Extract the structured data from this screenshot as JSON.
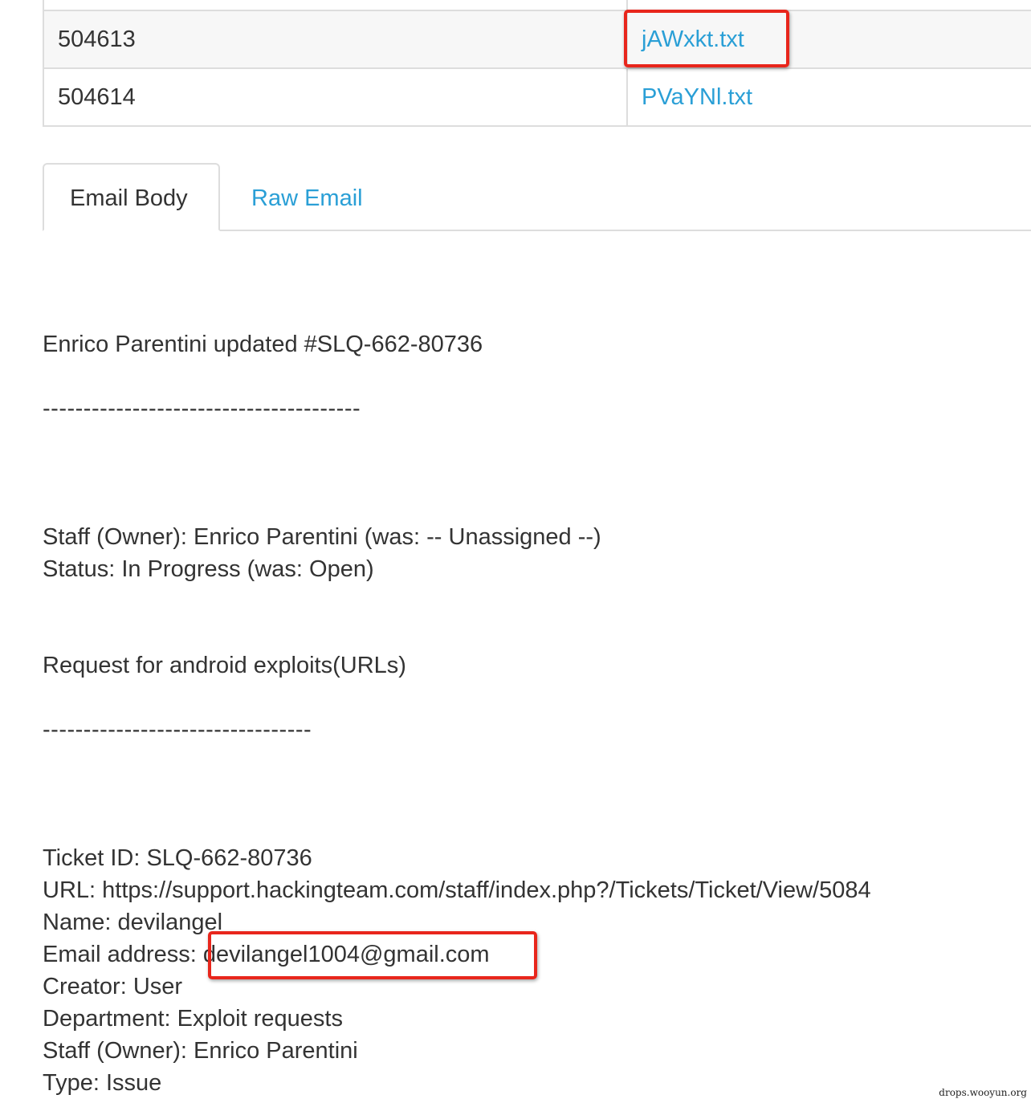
{
  "attachments": {
    "rows": [
      {
        "id": "504613",
        "filename": "jAWxkt.txt"
      },
      {
        "id": "504614",
        "filename": "PVaYNl.txt"
      }
    ]
  },
  "tabs": {
    "email_body": "Email Body",
    "raw_email": "Raw Email"
  },
  "email": {
    "headline": "Enrico Parentini updated #SLQ-662-80736",
    "separator_1": "---------------------------------------",
    "staff_owner_change": "Staff (Owner): Enrico Parentini (was: -- Unassigned --)",
    "status_change": "Status: In Progress (was: Open)",
    "subject": "Request for android exploits(URLs)",
    "separator_2": "---------------------------------",
    "ticket_id": "Ticket ID: SLQ-662-80736",
    "url": "URL: https://support.hackingteam.com/staff/index.php?/Tickets/Ticket/View/5084",
    "name": "Name: devilangel",
    "email_label": "Email address: ",
    "email_value": "devilangel1004@gmail.com",
    "creator": "Creator: User",
    "department": "Department: Exploit requests",
    "staff_owner": "Staff (Owner): Enrico Parentini",
    "type": "Type: Issue"
  },
  "watermark": "drops.wooyun.org",
  "colors": {
    "link": "#2a9fd6",
    "text": "#333333",
    "highlight": "#e8261c",
    "border": "#dddddd"
  }
}
